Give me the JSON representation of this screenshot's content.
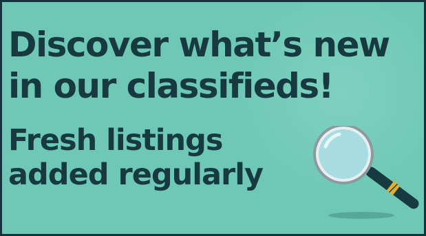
{
  "banner": {
    "headline_line1": "Discover what’s new",
    "headline_line2": "in our classifieds!",
    "subhead_line1": "Fresh listings",
    "subhead_line2": "added regularly",
    "illustration": "magnifying-glass-icon"
  },
  "colors": {
    "background": "#6ec8b5",
    "text": "#163a40",
    "border": "#12343a",
    "lens_glass": "#a7dce0",
    "lens_rim": "#8c9aa0",
    "handle": "#163a40",
    "handle_band": "#e0b030"
  }
}
